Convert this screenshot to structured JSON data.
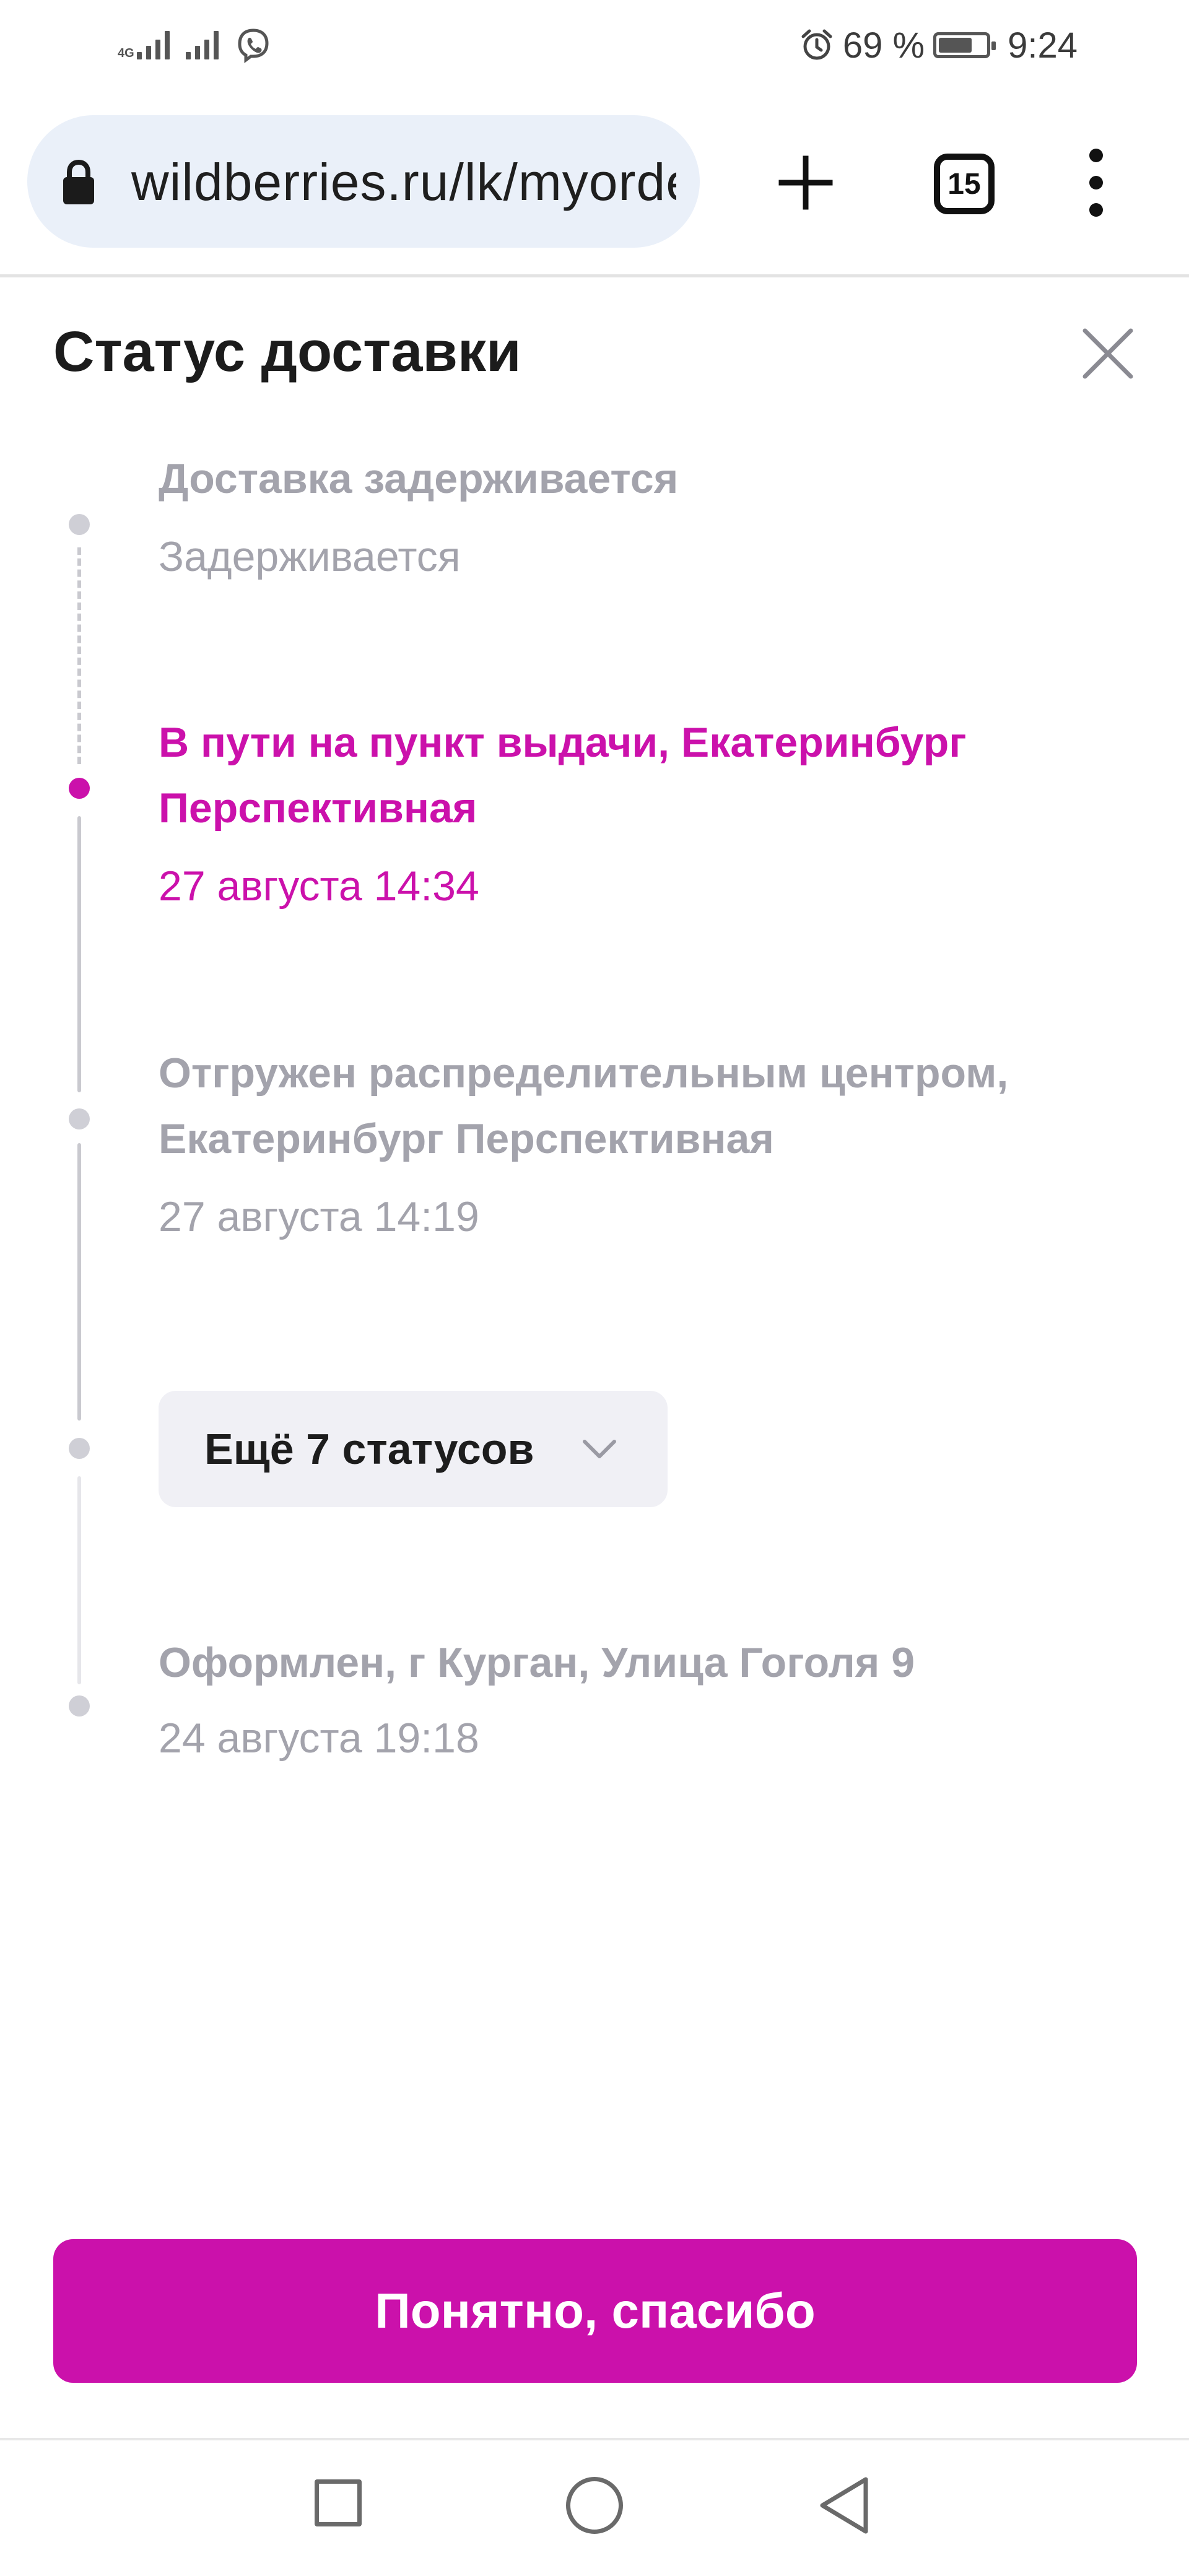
{
  "status_bar": {
    "network_label": "4G",
    "alarm_icon": "alarm-clock-icon",
    "battery_text": "69 %",
    "battery_level": 0.69,
    "time": "9:24"
  },
  "browser": {
    "url": "wildberries.ru/lk/myorders",
    "tab_count": "15"
  },
  "modal": {
    "title": "Статус доставки",
    "statuses": [
      {
        "title": "Доставка задерживается",
        "subtitle": "Задерживается"
      },
      {
        "title_line1": "В пути на пункт выдачи, Екатеринбург",
        "title_line2": "Перспективная",
        "date": "27 августа 14:34"
      },
      {
        "title_line1": "Отгружен распределительным центром,",
        "title_line2": "Екатеринбург Перспективная",
        "date": "27 августа 14:19"
      },
      {
        "title": "Оформлен, г Курган, Улица Гоголя 9",
        "date": "24 августа 19:18"
      }
    ],
    "more_button": "Ещё 7 статусов",
    "confirm_button": "Понятно, спасибо"
  },
  "colors": {
    "accent": "#cb11ab",
    "muted_text": "#a3a3ac",
    "timeline": "#c9c9cf"
  }
}
